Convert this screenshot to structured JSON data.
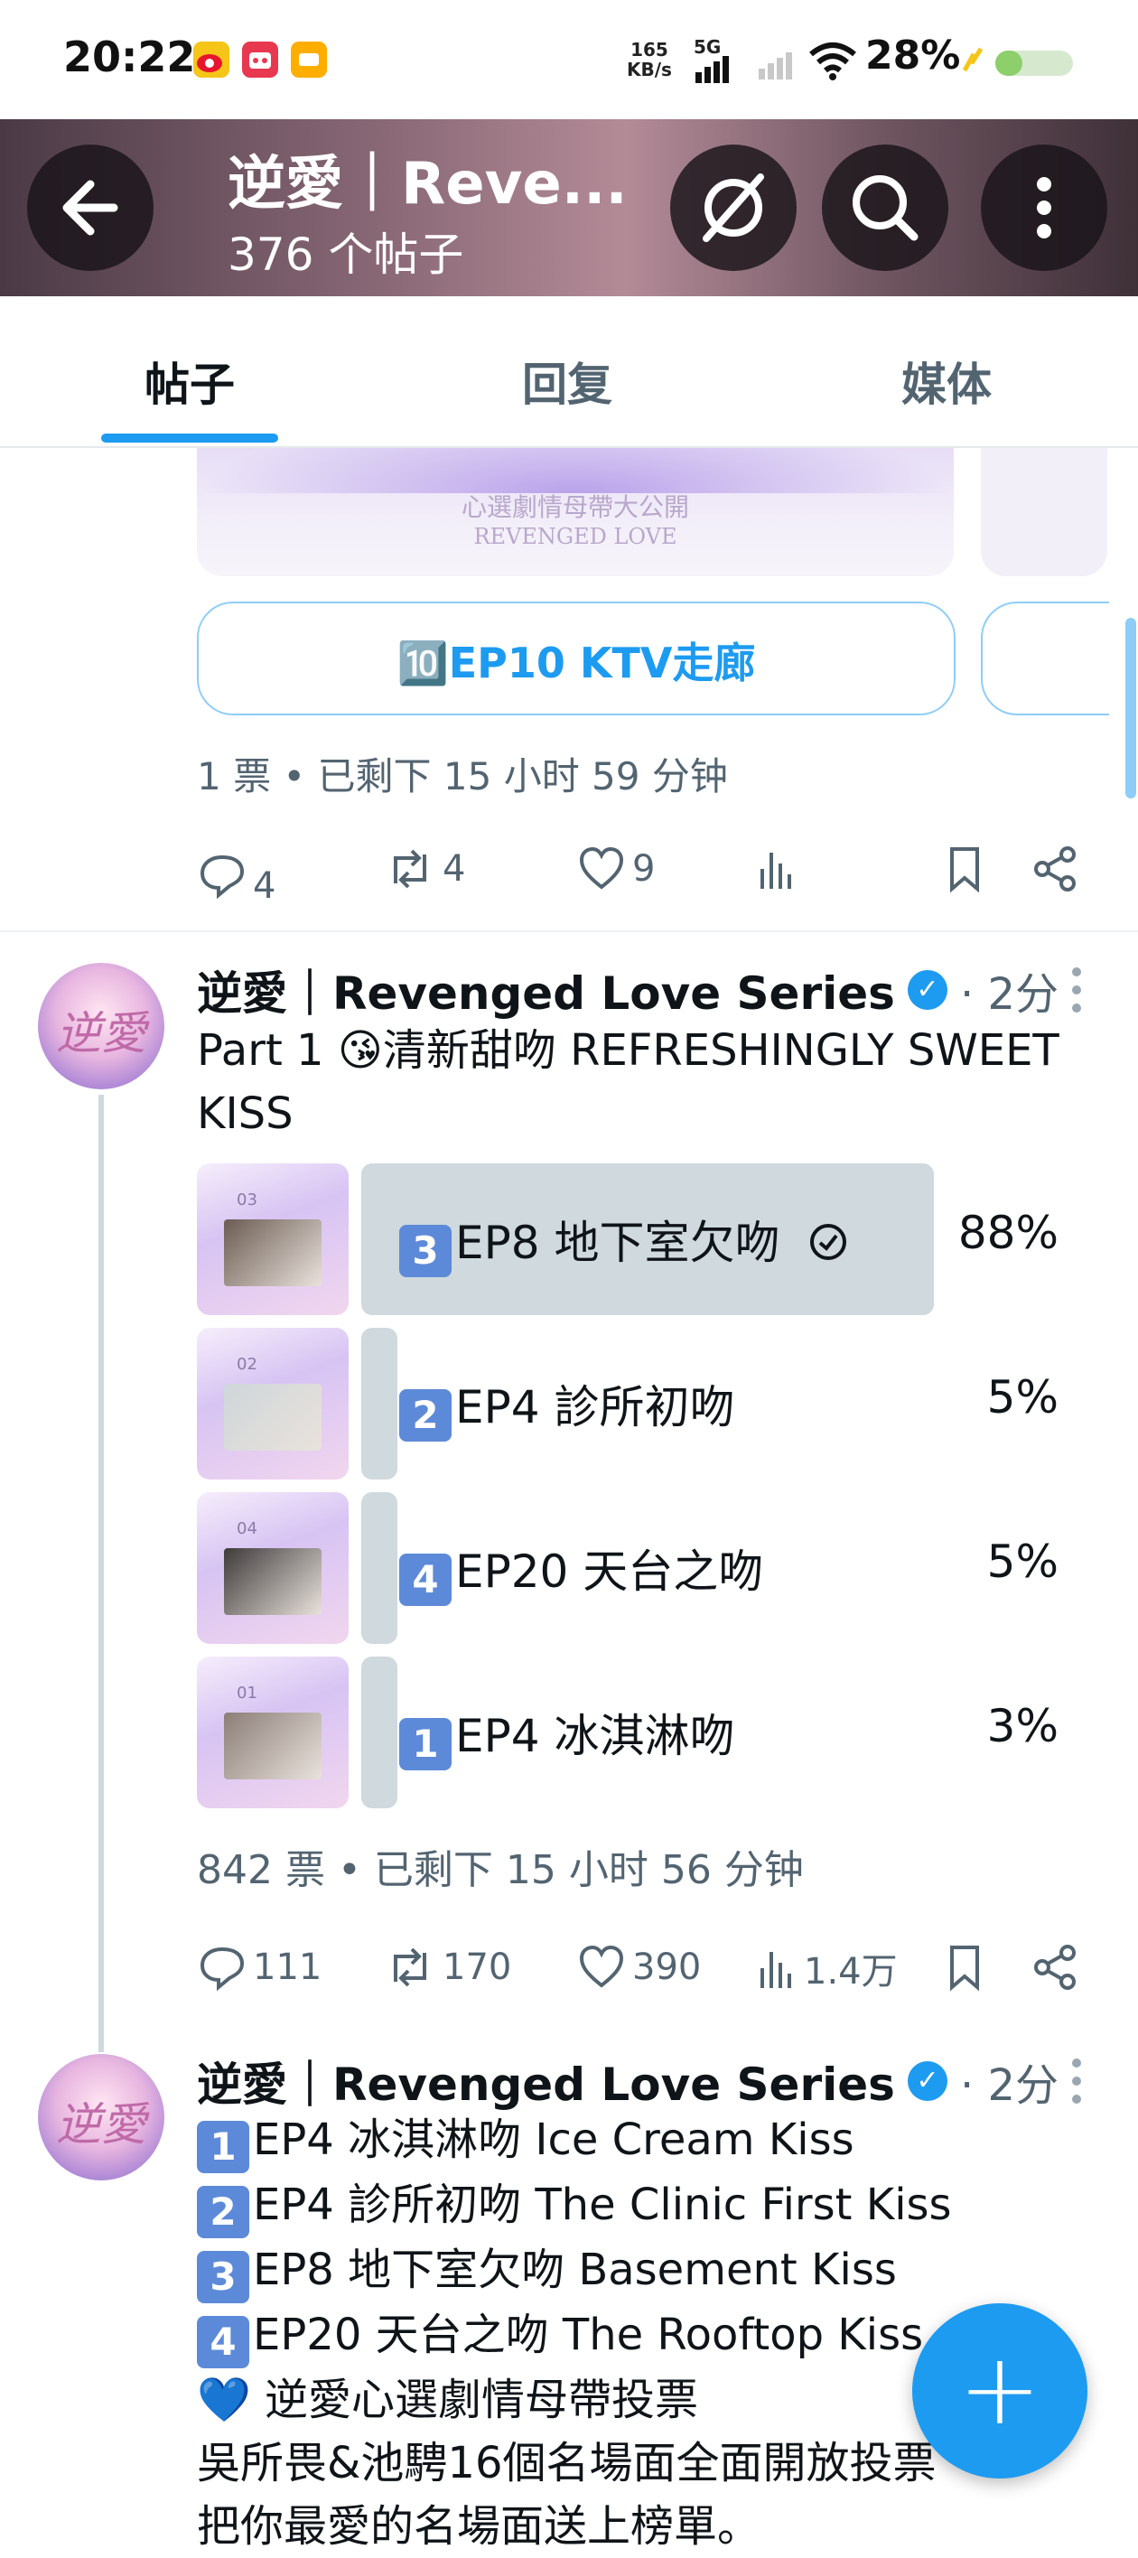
{
  "status_bar": {
    "time": "20:22",
    "net_speed_top": "165",
    "net_speed_bottom": "KB/s",
    "net_type": "5G",
    "battery": "28%"
  },
  "header": {
    "title": "逆愛｜Reve...",
    "subtitle": "376 个帖子"
  },
  "tabs": [
    {
      "label": "帖子"
    },
    {
      "label": "回复"
    },
    {
      "label": "媒体"
    }
  ],
  "post1": {
    "image_caption_cn": "心選劇情母帶大公開",
    "image_caption_en": "REVENGED LOVE",
    "poll_option": "🔟EP10 KTV走廊",
    "poll_footer": "1 票 • 已剩下 15 小时 59 分钟",
    "actions": {
      "replies": "4",
      "reposts": "4",
      "likes": "9"
    }
  },
  "post2": {
    "author": "逆愛｜Revenged Love Series",
    "avatar_text": "逆愛",
    "time": "· 2分",
    "text_line1": "Part 1 😘清新甜吻 REFRESHINGLY SWEET",
    "text_line2": "KISS",
    "poll": [
      {
        "num": "3",
        "label": "EP8 地下室欠吻",
        "pct": "88%",
        "fraction": 0.88,
        "selected": true,
        "thumb_no": "03"
      },
      {
        "num": "2",
        "label": "EP4 診所初吻",
        "pct": "5%",
        "fraction": 0.05,
        "selected": false,
        "thumb_no": "02"
      },
      {
        "num": "4",
        "label": "EP20 天台之吻",
        "pct": "5%",
        "fraction": 0.05,
        "selected": false,
        "thumb_no": "04"
      },
      {
        "num": "1",
        "label": "EP4 冰淇淋吻",
        "pct": "3%",
        "fraction": 0.03,
        "selected": false,
        "thumb_no": "01"
      }
    ],
    "poll_footer": "842 票 • 已剩下 15 小时 56 分钟",
    "actions": {
      "replies": "111",
      "reposts": "170",
      "likes": "390",
      "views": "1.4万"
    }
  },
  "post3": {
    "author": "逆愛｜Revenged Love Series",
    "avatar_text": "逆愛",
    "time": "· 2分",
    "lines": [
      {
        "num": "1",
        "text": "EP4 冰淇淋吻 Ice Cream Kiss"
      },
      {
        "num": "2",
        "text": "EP4 診所初吻 The Clinic First Kiss"
      },
      {
        "num": "3",
        "text": "EP8 地下室欠吻 Basement Kiss"
      },
      {
        "num": "4",
        "text": "EP20 天台之吻 The Rooftop Kiss"
      }
    ],
    "heart_line": "💙 逆愛心選劇情母帶投票",
    "line6": "吳所畏&池騁16個名場面全面開放投票",
    "line7": "把你最愛的名場面送上榜單。"
  },
  "colors": {
    "accent": "#1d9bf0",
    "poll_bar": "#cfd9de",
    "muted": "#536471"
  }
}
